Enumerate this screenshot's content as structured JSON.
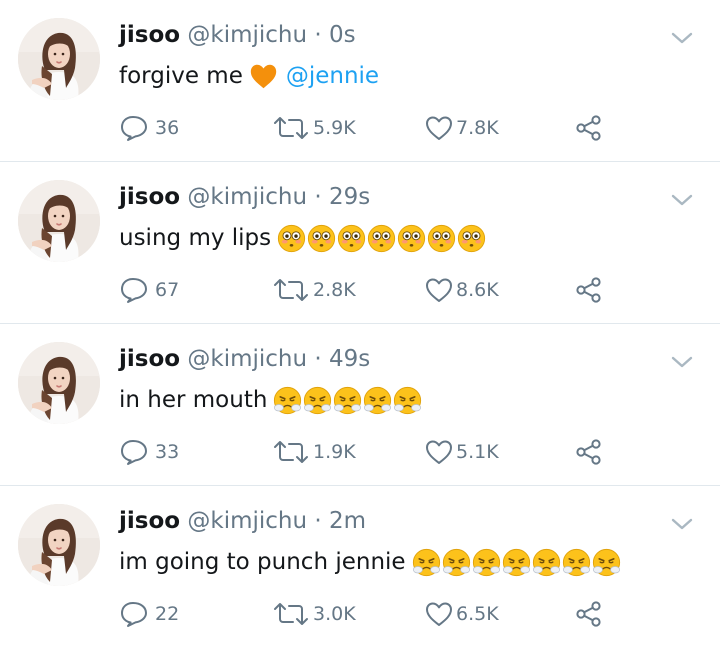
{
  "tweets": [
    {
      "name": "jisoo",
      "handle": "@kimjichu",
      "separator": "·",
      "time": "0s",
      "text": "forgive me",
      "emoji": [
        "orange-heart"
      ],
      "mention": "@jennie",
      "replies": "36",
      "retweets": "5.9K",
      "likes": "7.8K"
    },
    {
      "name": "jisoo",
      "handle": "@kimjichu",
      "separator": "·",
      "time": "29s",
      "text": "using my lips",
      "emoji": [
        "flushed-face",
        "flushed-face",
        "flushed-face",
        "flushed-face",
        "flushed-face",
        "flushed-face",
        "flushed-face"
      ],
      "mention": "",
      "replies": "67",
      "retweets": "2.8K",
      "likes": "8.6K"
    },
    {
      "name": "jisoo",
      "handle": "@kimjichu",
      "separator": "·",
      "time": "49s",
      "text": "in her mouth",
      "emoji": [
        "steam-face",
        "steam-face",
        "steam-face",
        "steam-face",
        "steam-face"
      ],
      "mention": "",
      "replies": "33",
      "retweets": "1.9K",
      "likes": "5.1K"
    },
    {
      "name": "jisoo",
      "handle": "@kimjichu",
      "separator": "·",
      "time": "2m",
      "text": "im going to punch jennie",
      "emoji": [
        "steam-face",
        "steam-face",
        "steam-face",
        "steam-face",
        "steam-face",
        "steam-face",
        "steam-face"
      ],
      "mention": "",
      "replies": "22",
      "retweets": "3.0K",
      "likes": "6.5K"
    }
  ],
  "colors": {
    "link": "#1da1f2",
    "muted": "#657786",
    "text": "#14171a",
    "divider": "#e1e8ed"
  },
  "icons": {
    "reply": "reply-icon",
    "retweet": "retweet-icon",
    "like": "heart-icon",
    "share": "share-icon",
    "menu": "chevron-down-icon"
  }
}
